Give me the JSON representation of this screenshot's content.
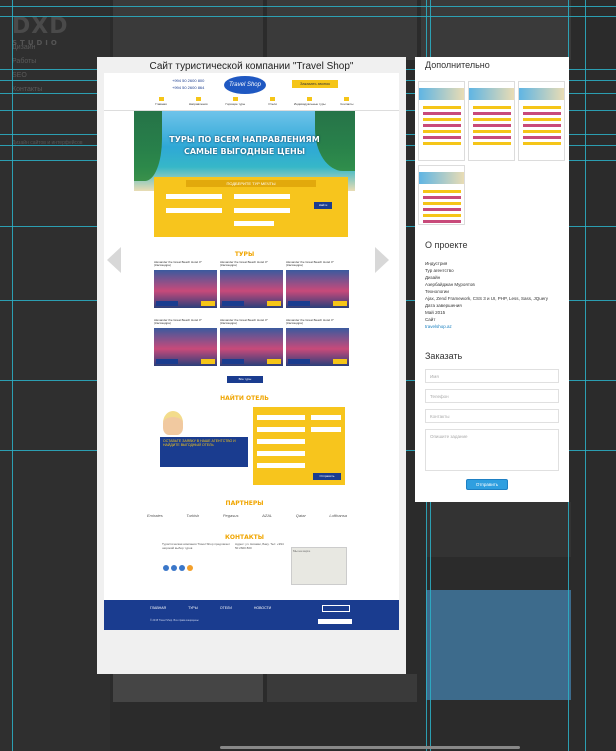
{
  "background": {
    "logo": "DXD",
    "logo_sub": "STUDIO",
    "nav": [
      "Дизайн",
      "Работы",
      "SEO",
      "Контакты"
    ],
    "sub_text": "Дизайн сайтов и интерфейсов"
  },
  "modal": {
    "title": "Сайт туристической компании \"Travel Shop\"",
    "site": {
      "phones": [
        "+994 50 2600 800",
        "+994 50 2600 864"
      ],
      "logo": "Travel Shop",
      "cta": "Заказать звонок",
      "menu": [
        "Главная",
        "Направления",
        "Горящие туры",
        "Отели",
        "Индивидуальные туры",
        "Контакты"
      ],
      "hero_line1": "ТУРЫ ПО ВСЕМ НАПРАВЛЕНИЯМ",
      "hero_line2": "САМЫЕ ВЫГОДНЫЕ ЦЕНЫ",
      "search_title": "ПОДБЕРИТЕ ТУР МЕЧТЫ",
      "search_button": "Найти",
      "tours_title": "ТУРЫ",
      "tours": [
        "Alexander the Great Beach Hotel 4* (Кассандра)",
        "Alexander the Great Beach Hotel 4* (Кассандра)",
        "Alexander the Great Beach Hotel 4* (Кассандра)",
        "Alexander the Great Beach Hotel 4* (Кассандра)",
        "Alexander the Great Beach Hotel 4* (Кассандра)",
        "Alexander the Great Beach Hotel 4* (Кассандра)"
      ],
      "more_button": "Все туры",
      "hotel_title": "НАЙТИ ОТЕЛЬ",
      "hotel_banner": "ОСТАВЬТЕ ЗАЯВКУ В НАШЕ АГЕНТСТВО И НАЙДИТЕ ВЫГОДНЫЙ ОТЕЛЬ",
      "hotel_submit": "Отправить",
      "partners_title": "ПАРТНЕРЫ",
      "partners": [
        "Emirates",
        "Turkish",
        "Pegasus",
        "AZAL",
        "Qatar",
        "Lufthansa"
      ],
      "contacts_title": "КОНТАКТЫ",
      "contacts_text": "Туристическая компания Travel Shop предлагает широкий выбор туров",
      "contacts_address": "Адрес: ул. Низами, Баку. Тел: +994 50 2600 800",
      "map_label": "Мы на карте",
      "footer_nav": [
        "ГЛАВНАЯ",
        "ТУРЫ",
        "ОТЕЛИ",
        "НОВОСТИ"
      ],
      "footer_copy": "© 2015 Travel Shop. Все права защищены"
    },
    "right": {
      "extra_heading": "Дополнительно",
      "about_heading": "О проекте",
      "info": [
        "Индустрия",
        "Тур агентство",
        "Дизайн",
        "Азербайджан Муроятов",
        "Технологии",
        "Ajax, Zend Framework, CSS 3 и UI, PHP, Less, Sass, JQuery",
        "Дата завершения",
        "Май 2015",
        "Сайт"
      ],
      "site_link": "travelshop.az",
      "order_heading": "Заказать",
      "name_placeholder": "Имя",
      "phone_placeholder": "Телефон",
      "email_placeholder": "Контакты",
      "message_placeholder": "Опишите задание",
      "send_button": "Отправить"
    }
  }
}
